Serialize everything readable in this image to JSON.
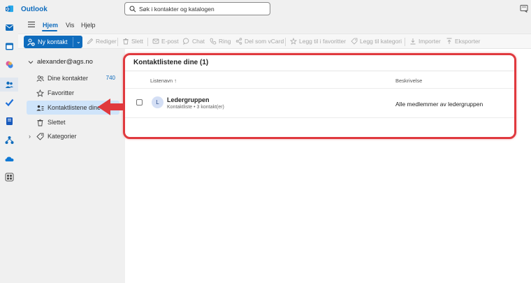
{
  "app": {
    "title": "Outlook",
    "brand_color": "#0f6cbd"
  },
  "search": {
    "placeholder": "Søk i kontakter og katalogen"
  },
  "ribbon": {
    "tabs": [
      "Hjem",
      "Vis",
      "Hjelp"
    ],
    "active_tab": "Hjem"
  },
  "toolbar": {
    "new_contact": "Ny kontakt",
    "items": [
      "Rediger",
      "Slett",
      "E-post",
      "Chat",
      "Ring",
      "Del som vCard",
      "Legg til i favoritter",
      "Legg til kategori",
      "Importer",
      "Eksporter"
    ]
  },
  "nav": {
    "account": "alexander@ags.no",
    "items": [
      {
        "label": "Dine kontakter",
        "count": "740"
      },
      {
        "label": "Favoritter",
        "count": ""
      },
      {
        "label": "Kontaktlistene dine",
        "count": ""
      },
      {
        "label": "Slettet",
        "count": ""
      },
      {
        "label": "Kategorier",
        "count": ""
      }
    ],
    "active_item": "Kontaktlistene dine"
  },
  "main": {
    "title": "Kontaktlistene dine (1)",
    "columns": {
      "name": "Listenavn ↑",
      "description": "Beskrivelse"
    },
    "rows": [
      {
        "avatar": "L",
        "name": "Ledergruppen",
        "subtitle": "Kontaktliste • 3 kontakt(er)",
        "description": "Alle medlemmer av ledergruppen"
      }
    ]
  },
  "annotation_color": "#e0393e"
}
